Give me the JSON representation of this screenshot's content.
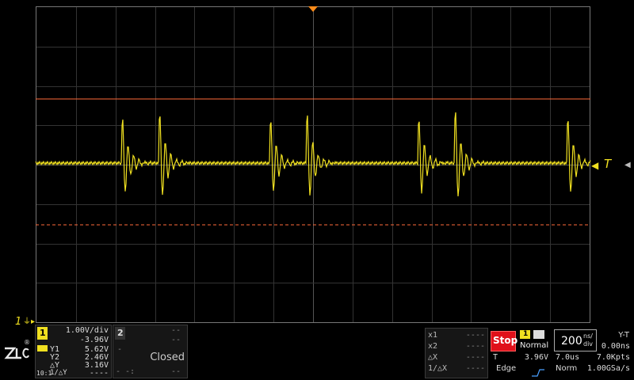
{
  "scope": {
    "trigger_marker": "T",
    "ch1_ground_marker": "1",
    "colors": {
      "trace": "#f0e020",
      "ref_top": "#ff6a3a",
      "ref_bottom": "#ff6a3a",
      "trigger_orange": "#ff8c1a",
      "stop": "#e0101a",
      "grid": "#3c3c3c"
    }
  },
  "logo": {
    "text": "ZLG",
    "registered": "®"
  },
  "ch1": {
    "number": "1",
    "scale": "1.00V/div",
    "offset": "-3.96V",
    "y1_label": "Y1",
    "y1_value": "5.62V",
    "y2_label": "Y2",
    "y2_value": "2.46V",
    "dy_label": "△Y",
    "dy_value": "3.16V",
    "ratio_label": "10:1",
    "inv_dy_label": "1/△Y",
    "inv_dy_value": "----"
  },
  "ch2": {
    "number": "2",
    "scale": "--",
    "offset": "--",
    "minus": "-",
    "status": "Closed",
    "dashes": "--",
    "small_dashes": "- -:"
  },
  "cursor": {
    "x1_label": "x1",
    "x1_value": "----",
    "x2_label": "x2",
    "x2_value": "----",
    "dx_label": "△X",
    "dx_value": "----",
    "inv_dx_label": "1/△X",
    "inv_dx_value": "----"
  },
  "run": {
    "state": "Stop"
  },
  "trigger": {
    "source": "1",
    "mode": "Normal",
    "level_label": "T",
    "level": "3.96V",
    "type": "Edge"
  },
  "timebase": {
    "scale": "200",
    "unit_top": "ns/",
    "unit_bottom": "div",
    "display": "Y-T",
    "delay": "0.00ns",
    "window": "7.0us",
    "points": "7.0Kpts",
    "acq": "Norm",
    "rate": "1.00GSa/s"
  }
}
